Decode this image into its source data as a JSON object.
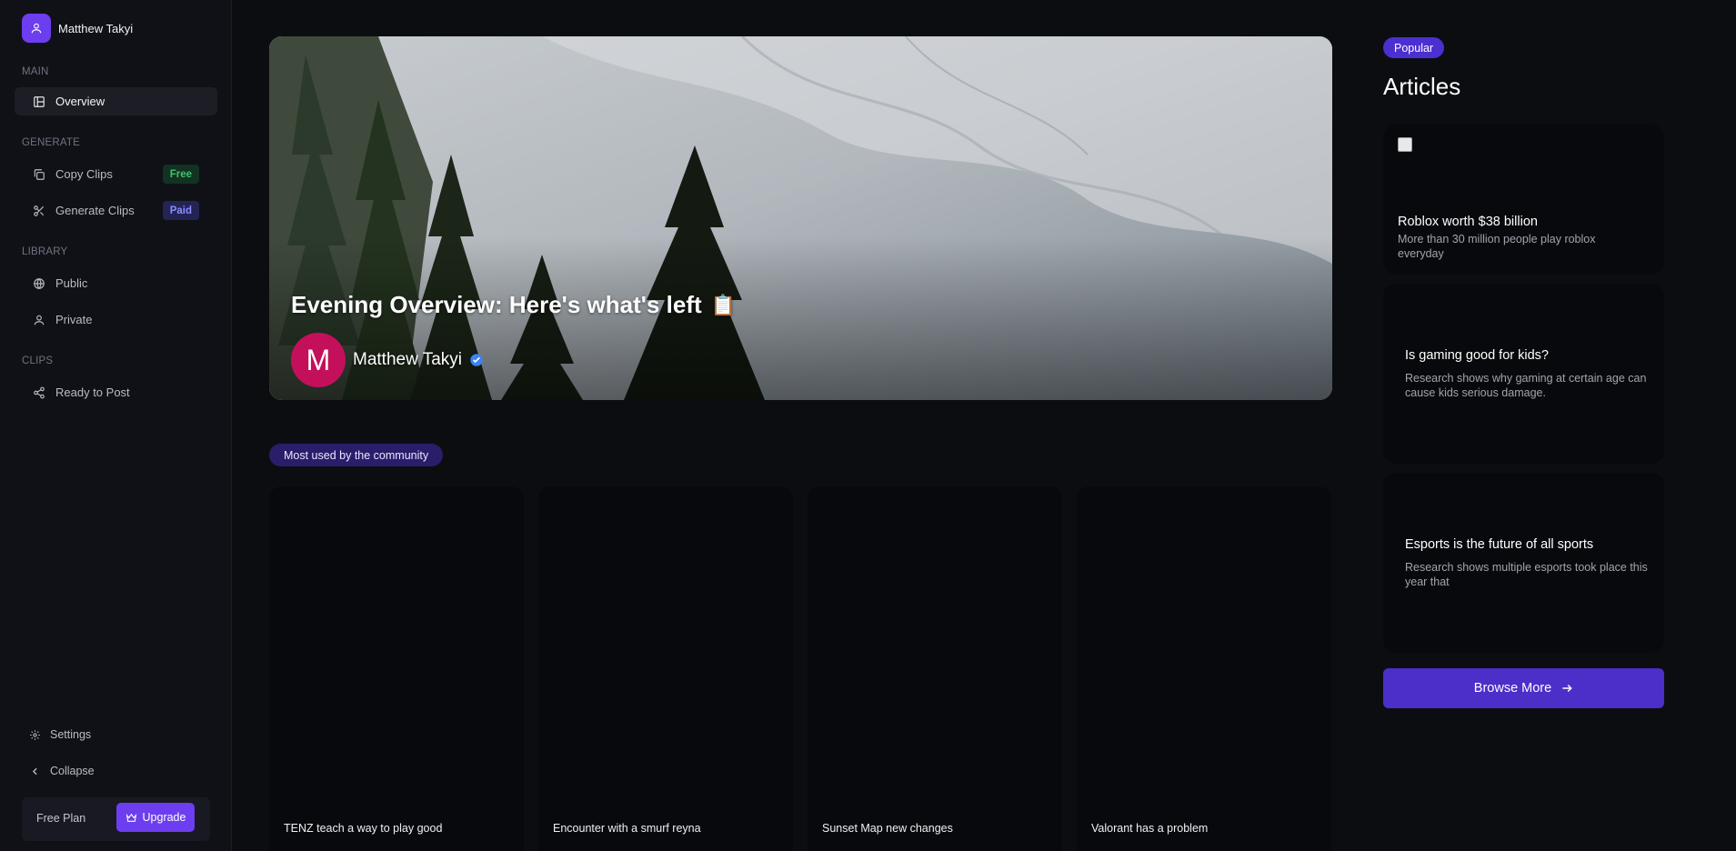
{
  "user": {
    "name": "Matthew Takyi"
  },
  "sidebar": {
    "sections": {
      "main": "MAIN",
      "generate": "GENERATE",
      "library": "LIBRARY",
      "clips": "CLIPS"
    },
    "items": [
      {
        "label": "Overview",
        "icon": "layout-icon"
      },
      {
        "label": "Copy Clips",
        "icon": "copy-icon",
        "badge": "Free"
      },
      {
        "label": "Generate Clips",
        "icon": "scissors-icon",
        "badge": "Paid"
      },
      {
        "label": "Public",
        "icon": "globe-icon"
      },
      {
        "label": "Private",
        "icon": "user-icon"
      },
      {
        "label": "Ready to Post",
        "icon": "share-icon"
      }
    ],
    "settings_label": "Settings",
    "collapse_label": "Collapse",
    "plan_label": "Free Plan",
    "upgrade_label": "Upgrade"
  },
  "hero": {
    "title": "Evening Overview: Here's what's left",
    "emoji": "📋",
    "author_initial": "M",
    "author_name": "Matthew Takyi"
  },
  "community": {
    "pill": "Most used by the community",
    "clips": [
      {
        "title": "TENZ teach a way to play good"
      },
      {
        "title": "Encounter with a smurf reyna"
      },
      {
        "title": "Sunset Map new changes"
      },
      {
        "title": "Valorant has a problem"
      }
    ]
  },
  "articles": {
    "pill": "Popular",
    "heading": "Articles",
    "items": [
      {
        "title": "Roblox worth $38 billion",
        "desc": "More than 30 million people play roblox everyday"
      },
      {
        "title": "Is gaming good for kids?",
        "desc": "Research shows why gaming at certain age can cause kids serious damage."
      },
      {
        "title": "Esports is the future of all sports",
        "desc": "Research shows multiple esports took place this year that"
      }
    ],
    "browse_label": "Browse More"
  },
  "colors": {
    "accent": "#6c3ef0",
    "background": "#0c0d11"
  }
}
